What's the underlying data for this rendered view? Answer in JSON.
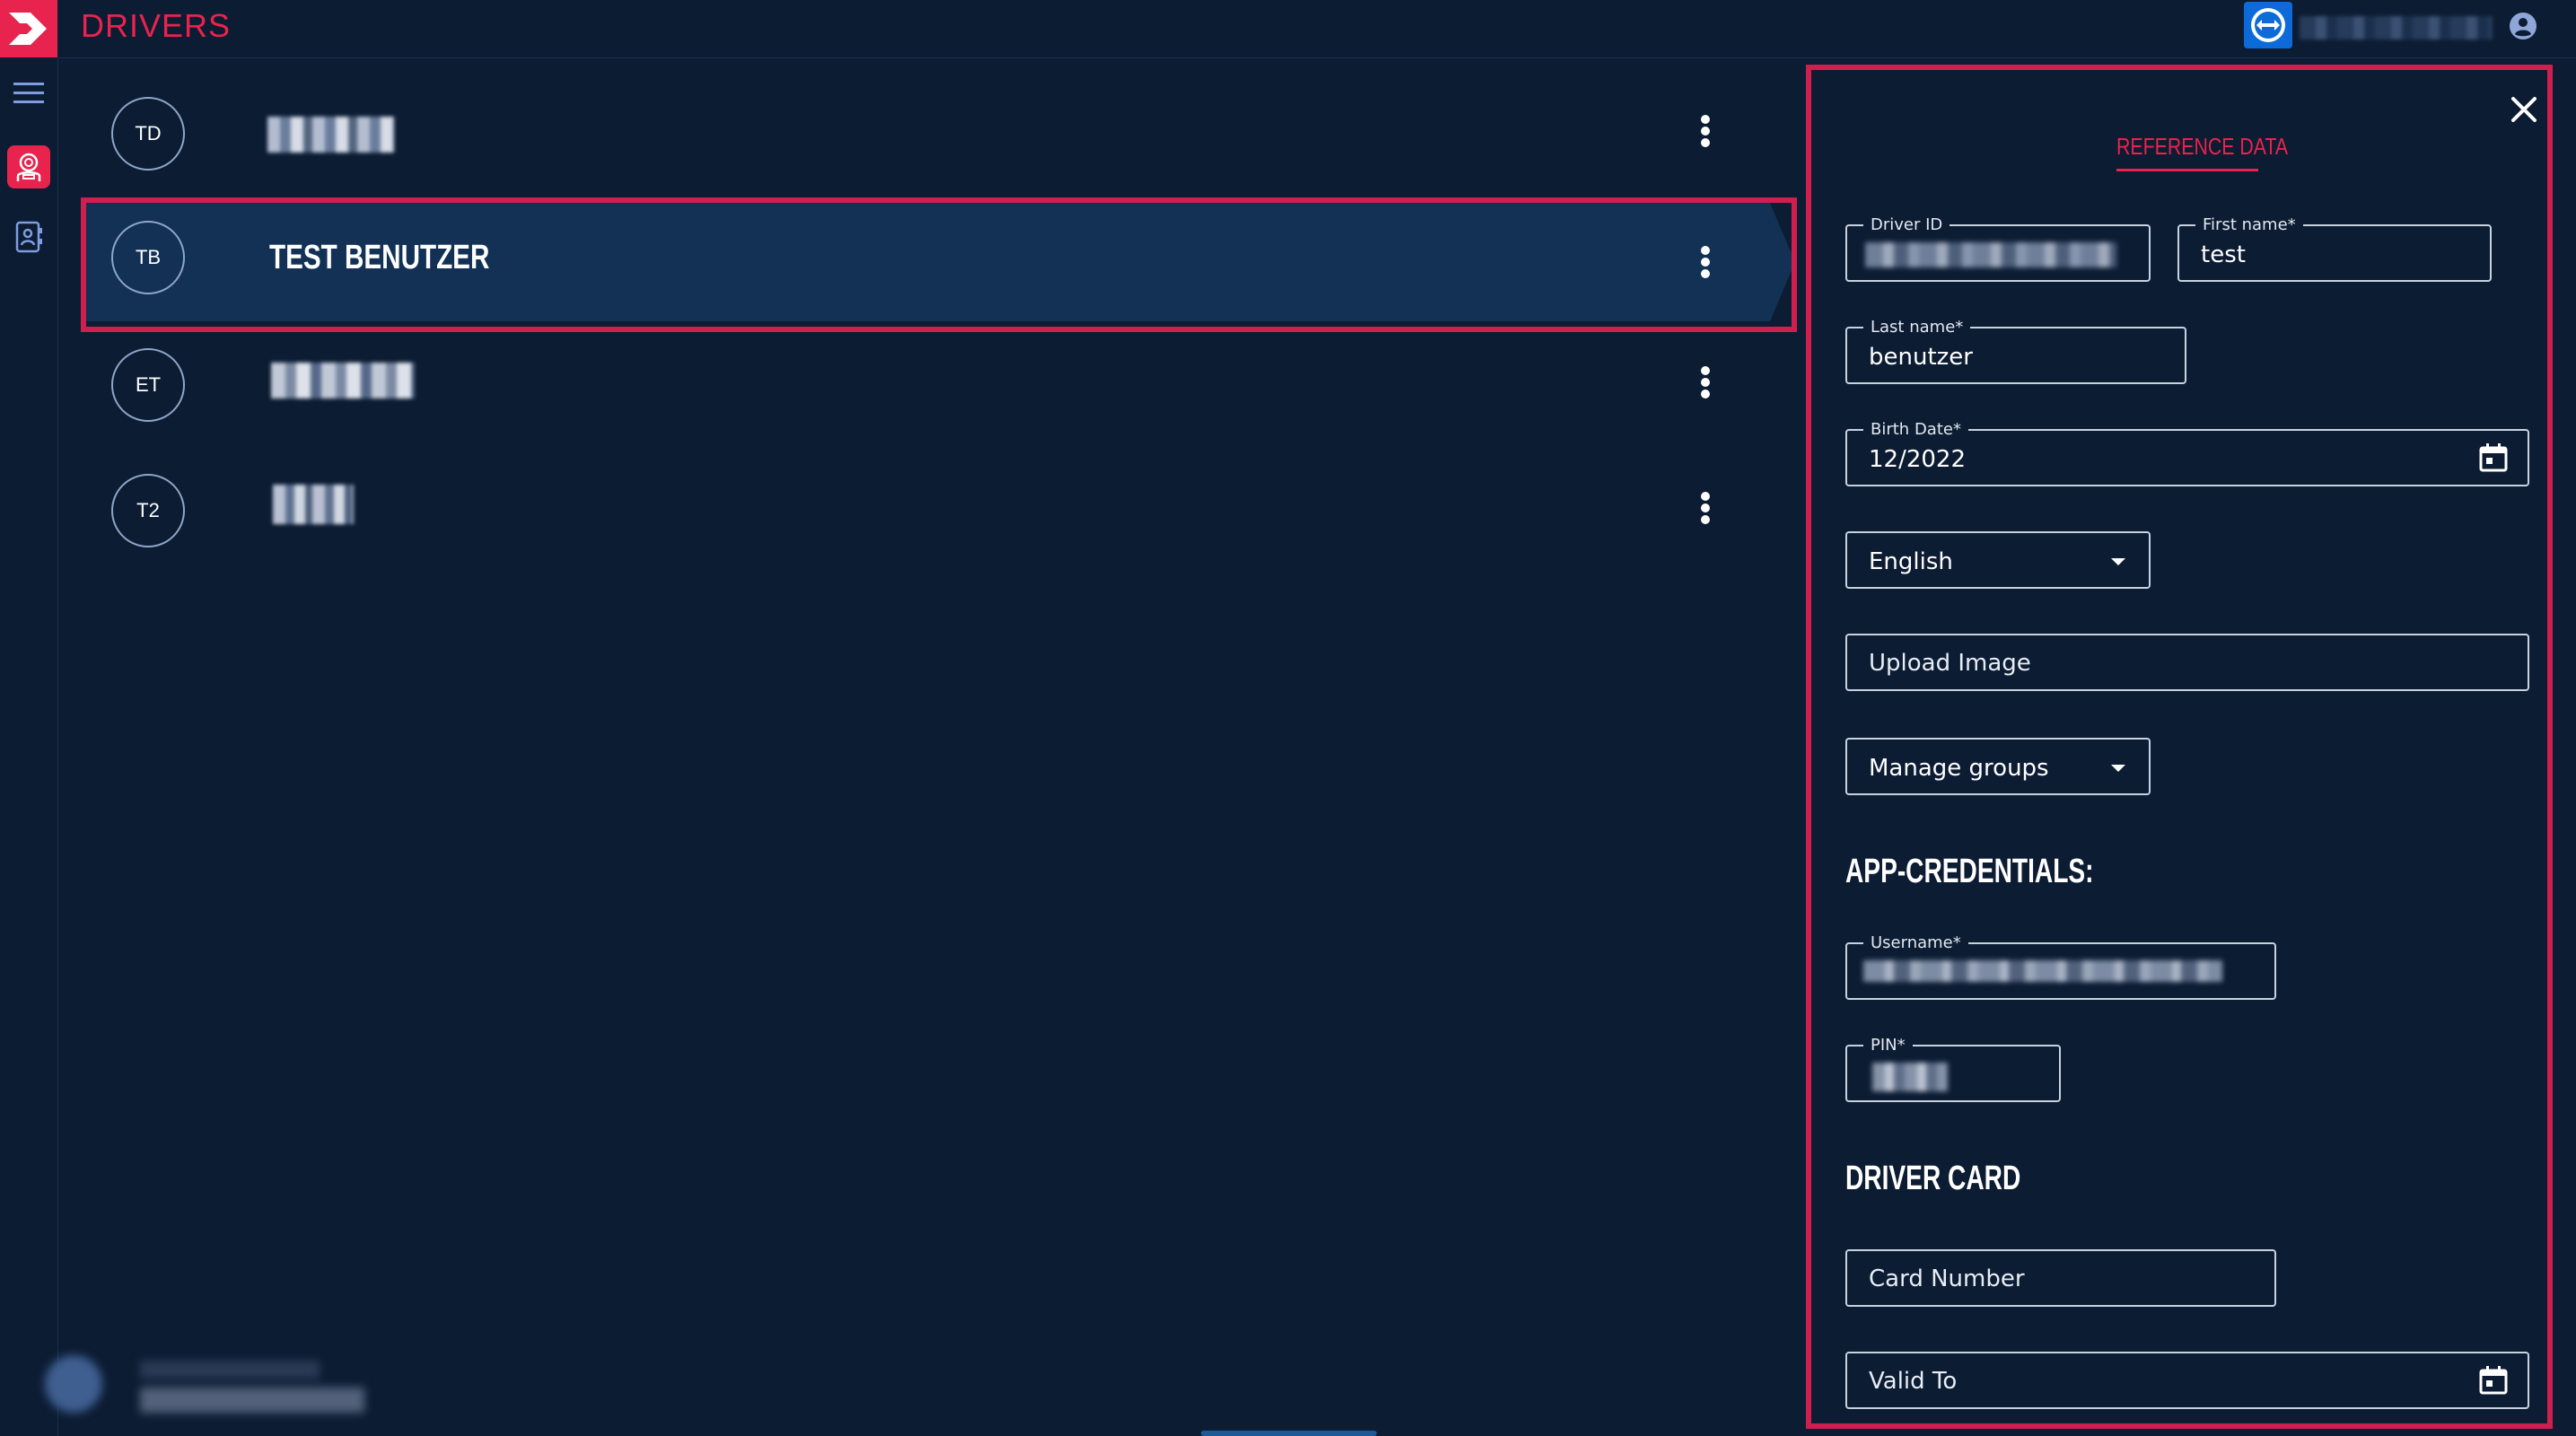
{
  "app": {
    "title": "DRIVERS"
  },
  "drivers": [
    {
      "initials": "TD",
      "name": ""
    },
    {
      "initials": "TB",
      "name": "TEST BENUTZER"
    },
    {
      "initials": "ET",
      "name": ""
    },
    {
      "initials": "T2",
      "name": ""
    }
  ],
  "panel": {
    "tab_label": "REFERENCE DATA",
    "driver_id": {
      "label": "Driver ID",
      "value": ""
    },
    "first_name": {
      "label": "First name*",
      "value": "test"
    },
    "last_name": {
      "label": "Last name*",
      "value": "benutzer"
    },
    "birth_date": {
      "label": "Birth Date*",
      "value": "12/2022"
    },
    "language": {
      "value": "English"
    },
    "upload_image": {
      "placeholder": "Upload Image"
    },
    "manage_groups": {
      "value": "Manage groups"
    },
    "app_credentials_title": "APP-CREDENTIALS:",
    "username": {
      "label": "Username*",
      "value": ""
    },
    "pin": {
      "label": "PIN*",
      "value": ""
    },
    "driver_card_title": "DRIVER CARD",
    "card_number": {
      "placeholder": "Card Number"
    },
    "valid_to": {
      "placeholder": "Valid To"
    }
  },
  "colors": {
    "accent": "#e8234d",
    "background": "#0c1c33",
    "selected_row": "#123155"
  },
  "icons": [
    "app-logo-icon",
    "teamviewer-icon",
    "account-circle-icon",
    "menu-icon",
    "drivers-icon",
    "contacts-icon",
    "more-vert-icon",
    "close-icon",
    "calendar-icon",
    "dropdown-arrow-icon"
  ]
}
